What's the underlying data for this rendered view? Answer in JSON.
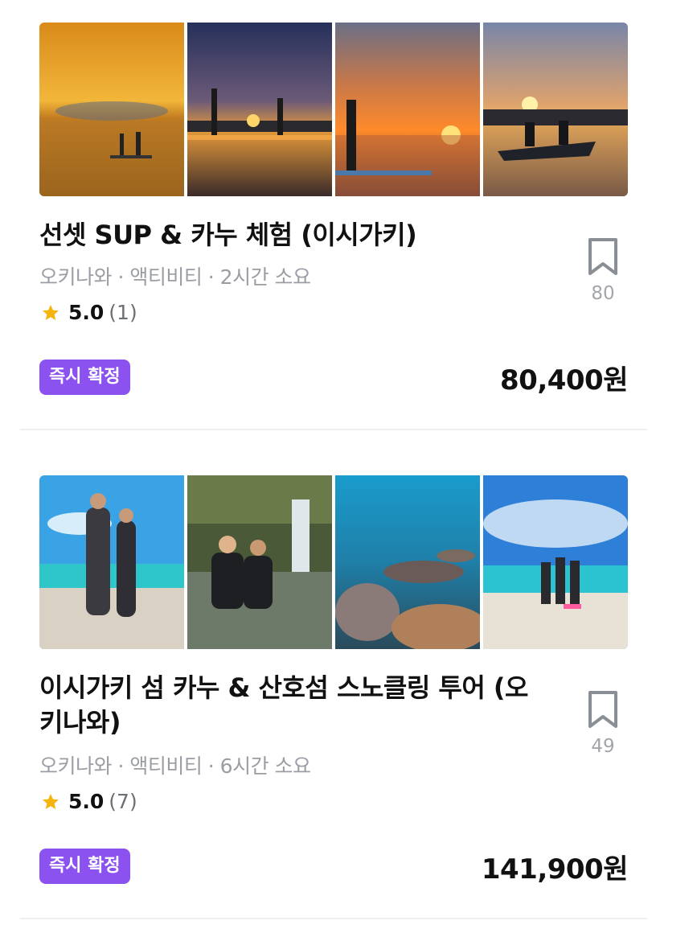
{
  "products": [
    {
      "title": "선셋 SUP & 카누 체험 (이시가키)",
      "meta": "오키나와 · 액티비티 · 2시간 소요",
      "rating": "5.0",
      "review_count": "(1)",
      "bookmark_count": "80",
      "badge": "즉시 확정",
      "price": "80,400원",
      "images": [
        "sunset-sup-photo",
        "sunset-sup-silhouette-photo",
        "sunset-paddler-photo",
        "sunset-canoe-photo"
      ]
    },
    {
      "title": "이시가키 섬 카누 & 산호섬 스노클링 투어 (오키나와)",
      "meta": "오키나와 · 액티비티 · 6시간 소요",
      "rating": "5.0",
      "review_count": "(7)",
      "bookmark_count": "49",
      "badge": "즉시 확정",
      "price": "141,900원",
      "images": [
        "beach-couple-photo",
        "waterfall-couple-photo",
        "coral-reef-photo",
        "beach-group-photo"
      ]
    }
  ],
  "colors": {
    "badge_bg": "#8b52f0",
    "star": "#f6b40e",
    "title": "#111111",
    "meta": "#9a9da3",
    "divider": "#eeeff1"
  }
}
